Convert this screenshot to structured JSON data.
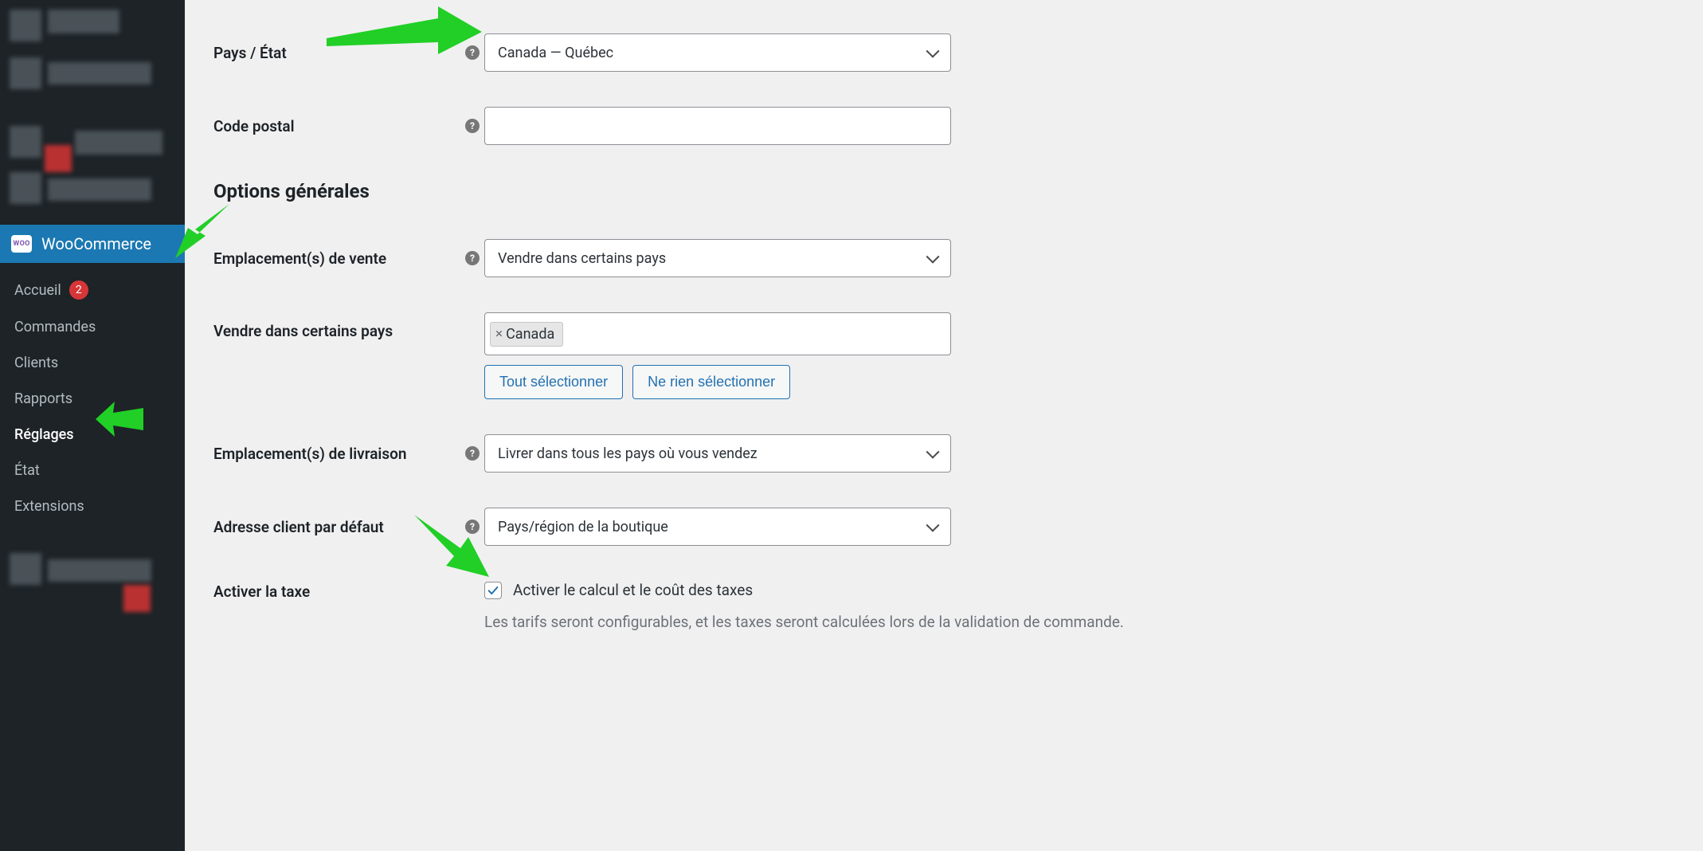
{
  "sidebar": {
    "woocommerce_label": "WooCommerce",
    "woo_badge": "WOO",
    "items": [
      {
        "label": "Accueil",
        "badge": "2"
      },
      {
        "label": "Commandes"
      },
      {
        "label": "Clients"
      },
      {
        "label": "Rapports"
      },
      {
        "label": "Réglages"
      },
      {
        "label": "État"
      },
      {
        "label": "Extensions"
      }
    ]
  },
  "form": {
    "country_state_label": "Pays / État",
    "country_state_value": "Canada — Québec",
    "postal_label": "Code postal",
    "postal_value": "",
    "section_heading": "Options générales",
    "sell_locations_label": "Emplacement(s) de vente",
    "sell_locations_value": "Vendre dans certains pays",
    "sell_countries_label": "Vendre dans certains pays",
    "sell_countries_chips": [
      "Canada"
    ],
    "select_all_btn": "Tout sélectionner",
    "select_none_btn": "Ne rien sélectionner",
    "ship_locations_label": "Emplacement(s) de livraison",
    "ship_locations_value": "Livrer dans tous les pays où vous vendez",
    "default_addr_label": "Adresse client par défaut",
    "default_addr_value": "Pays/région de la boutique",
    "enable_tax_label": "Activer la taxe",
    "enable_tax_checkbox_label": "Activer le calcul et le coût des taxes",
    "enable_tax_desc": "Les tarifs seront configurables, et les taxes seront calculées lors de la validation de commande."
  },
  "icons": {
    "help_glyph": "?"
  }
}
